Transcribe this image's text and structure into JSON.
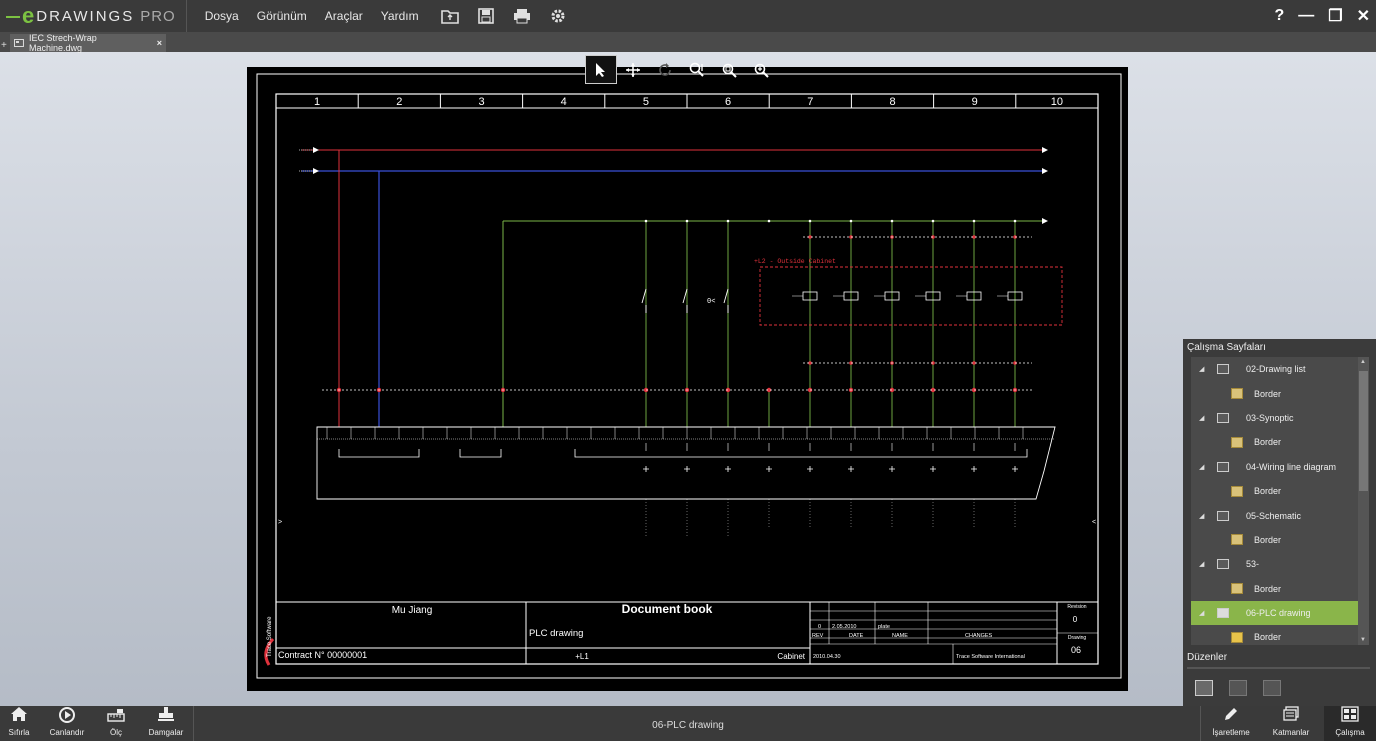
{
  "app": {
    "brand_e": "e",
    "brand_word": "DRAWINGS",
    "brand_pro": "PRO"
  },
  "menu": [
    "Dosya",
    "Görünüm",
    "Araçlar",
    "Yardım"
  ],
  "toolbar_icons": [
    "open-icon",
    "save-icon",
    "print-icon",
    "settings-gear-icon"
  ],
  "window": {
    "help": "?",
    "minimize": "—",
    "restore": "❐",
    "close": "✕"
  },
  "tab": {
    "label": "IEC Strech-Wrap Machine.dwg",
    "close": "×",
    "pin": "+"
  },
  "view_tools": [
    "select-arrow-icon",
    "pan-icon",
    "rotate-icon",
    "zoom-window-icon",
    "zoom-fit-icon",
    "zoom-icon"
  ],
  "drawing": {
    "columns": [
      "1",
      "2",
      "3",
      "4",
      "5",
      "6",
      "7",
      "8",
      "9",
      "10"
    ],
    "cabinet_label": "+L2 - Outside Cabinet",
    "title_block": {
      "author": "Mu Jiang",
      "title": "Document book",
      "subtitle": "PLC drawing",
      "contract": "Contract N° 00000001",
      "location": "+L1",
      "cabinet": "Cabinet",
      "rev_index": "0",
      "rev_date": "2.05.2010",
      "rev_note": "plate",
      "col_rev": "REV",
      "col_date": "DATE",
      "col_name": "NAME",
      "col_changes": "CHANGES",
      "drawing_date": "2010.04.30",
      "company": "Trace Software International",
      "revision_label": "Revision",
      "revision": "0",
      "drawing_label": "Drawing",
      "drawing_no": "06",
      "logo_text": "Trace Software"
    }
  },
  "panel": {
    "title": "Çalışma Sayfaları",
    "items": [
      {
        "label": "02-Drawing list",
        "child": "Border"
      },
      {
        "label": "03-Synoptic",
        "child": "Border"
      },
      {
        "label": "04-Wiring line diagram",
        "child": "Border"
      },
      {
        "label": "05-Schematic",
        "child": "Border"
      },
      {
        "label": "53-",
        "child": "Border"
      },
      {
        "label": "06-PLC drawing",
        "child": "Border"
      }
    ],
    "layouts_title": "Düzenler"
  },
  "bottom": {
    "buttons_left": [
      "Sıfırla",
      "Canlandır",
      "Ölç",
      "Damgalar"
    ],
    "status": "06-PLC drawing",
    "buttons_right": [
      "İşaretleme",
      "Katmanlar",
      "Çalışma"
    ]
  },
  "colors": {
    "accent_green": "#8ab54a",
    "brand_green": "#7cc242",
    "wire_red": "#e0323c",
    "wire_blue": "#3a4fd8",
    "wire_green": "#7ab648",
    "background": "#3a3a3a"
  }
}
